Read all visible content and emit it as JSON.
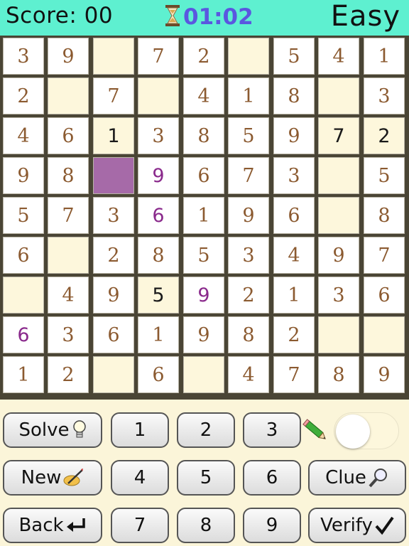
{
  "header": {
    "score_text": "Score: 00",
    "timer": "01:02",
    "level": "Easy"
  },
  "board": [
    [
      "3",
      "9",
      "",
      "7",
      "2",
      "",
      "5",
      "4",
      "1"
    ],
    [
      "2",
      "",
      "7",
      "",
      "4",
      "1",
      "8",
      "",
      "3"
    ],
    [
      "4",
      "6",
      "1",
      "3",
      "8",
      "5",
      "9",
      "7",
      "2"
    ],
    [
      "9",
      "8",
      "",
      "9",
      "6",
      "7",
      "3",
      "",
      "5"
    ],
    [
      "5",
      "7",
      "3",
      "6",
      "1",
      "9",
      "6",
      "",
      "8"
    ],
    [
      "6",
      "",
      "2",
      "8",
      "5",
      "3",
      "4",
      "9",
      "7"
    ],
    [
      "",
      "4",
      "9",
      "5",
      "9",
      "2",
      "1",
      "3",
      "6"
    ],
    [
      "6",
      "3",
      "6",
      "1",
      "9",
      "8",
      "2",
      "",
      ""
    ],
    [
      "1",
      "2",
      "",
      "6",
      "",
      "4",
      "7",
      "8",
      "9"
    ]
  ],
  "given_cells": [
    "2-2",
    "2-7",
    "2-8",
    "6-3"
  ],
  "user_cells": [
    "3-3",
    "4-3",
    "6-4",
    "7-0"
  ],
  "selected_cell": "3-2",
  "controls": {
    "solve": "Solve",
    "new": "New",
    "back": "Back",
    "clue": "Clue",
    "verify": "Verify",
    "digits": [
      "1",
      "2",
      "3",
      "4",
      "5",
      "6",
      "7",
      "8",
      "9"
    ],
    "pencil_mode_on": false
  },
  "colors": {
    "header_bg": "#5ef0d0",
    "timer": "#5a57e0",
    "selected": "#a66aa8",
    "user_digit": "#8a2a8c"
  }
}
